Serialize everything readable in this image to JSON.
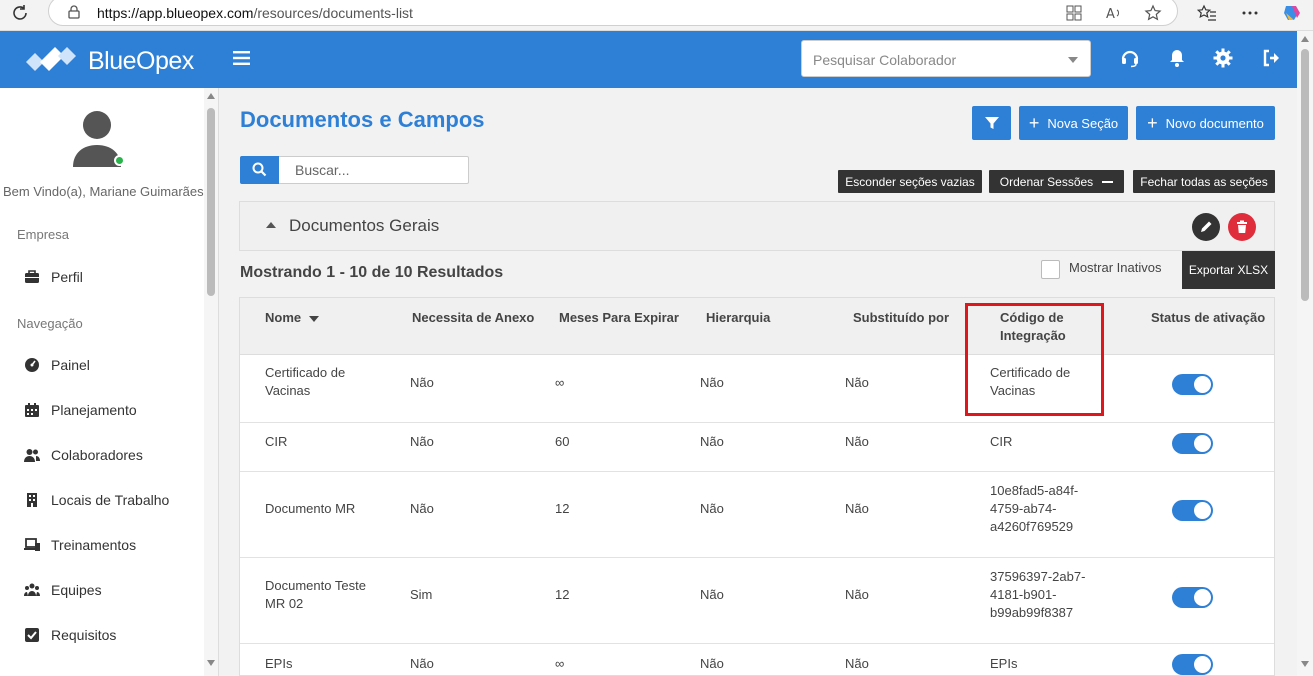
{
  "browser": {
    "url_host": "https://app.blueopex.com",
    "url_path": "/resources/documents-list"
  },
  "topbar": {
    "brand": "BlueOpex",
    "search_placeholder": "Pesquisar Colaborador",
    "accent_color": "#2e7fd6"
  },
  "sidebar": {
    "welcome": "Bem Vindo(a), Mariane Guimarães",
    "sections": [
      {
        "label": "Empresa",
        "items": [
          {
            "label": "Perfil",
            "icon": "briefcase-icon"
          }
        ]
      },
      {
        "label": "Navegação",
        "items": [
          {
            "label": "Painel",
            "icon": "gauge-icon"
          },
          {
            "label": "Planejamento",
            "icon": "calendar-icon"
          },
          {
            "label": "Colaboradores",
            "icon": "users-icon"
          },
          {
            "label": "Locais de Trabalho",
            "icon": "building-icon"
          },
          {
            "label": "Treinamentos",
            "icon": "laptop-icon"
          },
          {
            "label": "Equipes",
            "icon": "group-icon"
          },
          {
            "label": "Requisitos",
            "icon": "checkbox-icon"
          }
        ]
      }
    ]
  },
  "main": {
    "title": "Documentos e Campos",
    "new_section_label": "Nova Seção",
    "new_document_label": "Novo documento",
    "search_placeholder": "Buscar...",
    "hide_empty_label": "Esconder seções vazias",
    "order_sections_label": "Ordenar Sessões",
    "close_all_label": "Fechar todas as seções",
    "section_title": "Documentos Gerais",
    "results_text": "Mostrando 1 - 10 de 10 Resultados",
    "show_inactive_label": "Mostrar Inativos",
    "export_label": "Exportar XLSX"
  },
  "table": {
    "headers": {
      "name": "Nome",
      "needs_attachment": "Necessita de Anexo",
      "months_expire": "Meses Para Expirar",
      "hierarchy": "Hierarquia",
      "replaced_by": "Substituído por",
      "integration_code_1": "Código de",
      "integration_code_2": "Integração",
      "status": "Status de ativação"
    },
    "rows": [
      {
        "name_1": "Certificado de",
        "name_2": "Vacinas",
        "needs_attachment": "Não",
        "months": "∞",
        "hierarchy": "Não",
        "replaced_by": "Não",
        "code_1": "Certificado de",
        "code_2": "Vacinas",
        "code_3": "",
        "active": true
      },
      {
        "name_1": "CIR",
        "name_2": "",
        "needs_attachment": "Não",
        "months": "60",
        "hierarchy": "Não",
        "replaced_by": "Não",
        "code_1": "CIR",
        "code_2": "",
        "code_3": "",
        "active": true
      },
      {
        "name_1": "Documento MR",
        "name_2": "",
        "needs_attachment": "Não",
        "months": "12",
        "hierarchy": "Não",
        "replaced_by": "Não",
        "code_1": "10e8fad5-a84f-",
        "code_2": "4759-ab74-",
        "code_3": "a4260f769529",
        "active": true
      },
      {
        "name_1": "Documento Teste",
        "name_2": "MR 02",
        "needs_attachment": "Sim",
        "months": "12",
        "hierarchy": "Não",
        "replaced_by": "Não",
        "code_1": "37596397-2ab7-",
        "code_2": "4181-b901-",
        "code_3": "b99ab99f8387",
        "active": true
      },
      {
        "name_1": "EPIs",
        "name_2": "",
        "needs_attachment": "Não",
        "months": "∞",
        "hierarchy": "Não",
        "replaced_by": "Não",
        "code_1": "EPIs",
        "code_2": "",
        "code_3": "",
        "active": true
      }
    ]
  }
}
